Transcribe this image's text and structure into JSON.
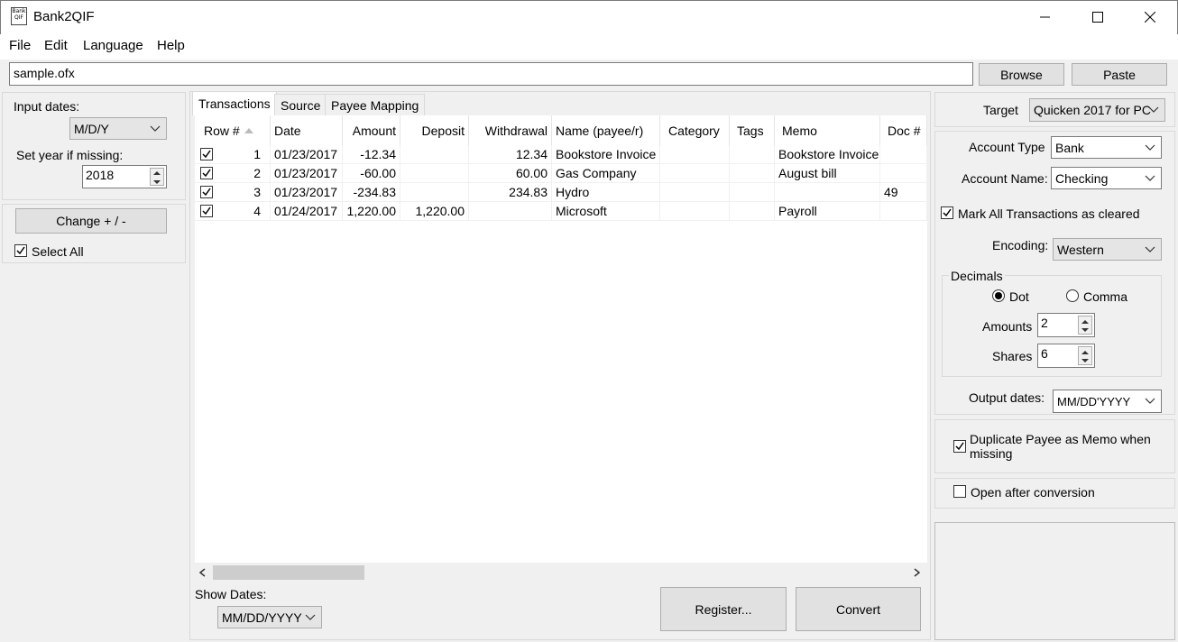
{
  "window": {
    "title": "Bank2QIF",
    "icon_text": "Bank QIF"
  },
  "menu": [
    "File",
    "Edit",
    "Language",
    "Help"
  ],
  "file_path": "sample.ofx",
  "buttons": {
    "browse": "Browse",
    "paste": "Paste",
    "change_sign": "Change + / -",
    "register": "Register...",
    "convert": "Convert"
  },
  "left": {
    "input_dates_label": "Input dates:",
    "input_dates_value": "M/D/Y",
    "year_label": "Set year if missing:",
    "year_value": "2018",
    "select_all_label": "Select All"
  },
  "tabs": [
    "Transactions",
    "Source",
    "Payee Mapping"
  ],
  "table": {
    "columns": [
      "Row #",
      "Date",
      "Amount",
      "Deposit",
      "Withdrawal",
      "Name (payee/r)",
      "Category",
      "Tags",
      "Memo",
      "Doc #"
    ],
    "rows": [
      {
        "checked": true,
        "row": "1",
        "date": "01/23/2017",
        "amount": "-12.34",
        "deposit": "",
        "withdrawal": "12.34",
        "name": "Bookstore Invoice",
        "category": "",
        "tags": "",
        "memo": "Bookstore Invoice",
        "doc": ""
      },
      {
        "checked": true,
        "row": "2",
        "date": "01/23/2017",
        "amount": "-60.00",
        "deposit": "",
        "withdrawal": "60.00",
        "name": "Gas Company",
        "category": "",
        "tags": "",
        "memo": "August bill",
        "doc": ""
      },
      {
        "checked": true,
        "row": "3",
        "date": "01/23/2017",
        "amount": "-234.83",
        "deposit": "",
        "withdrawal": "234.83",
        "name": "Hydro",
        "category": "",
        "tags": "",
        "memo": "",
        "doc": "49"
      },
      {
        "checked": true,
        "row": "4",
        "date": "01/24/2017",
        "amount": "1,220.00",
        "deposit": "1,220.00",
        "withdrawal": "",
        "name": "Microsoft",
        "category": "",
        "tags": "",
        "memo": "Payroll",
        "doc": ""
      }
    ]
  },
  "show_dates": {
    "label": "Show Dates:",
    "value": "MM/DD/YYYY"
  },
  "right": {
    "target_label": "Target",
    "target_value": "Quicken 2017 for PC",
    "account_type_label": "Account Type",
    "account_type_value": "Bank",
    "account_name_label": "Account Name:",
    "account_name_value": "Checking",
    "mark_cleared_label": "Mark All Transactions as cleared",
    "encoding_label": "Encoding:",
    "encoding_value": "Western",
    "decimals_label": "Decimals",
    "dot_label": "Dot",
    "comma_label": "Comma",
    "amounts_label": "Amounts",
    "amounts_value": "2",
    "shares_label": "Shares",
    "shares_value": "6",
    "output_dates_label": "Output dates:",
    "output_dates_value": "MM/DD'YYYY",
    "dup_payee_label": "Duplicate Payee as Memo when missing",
    "open_after_label": "Open after conversion"
  }
}
